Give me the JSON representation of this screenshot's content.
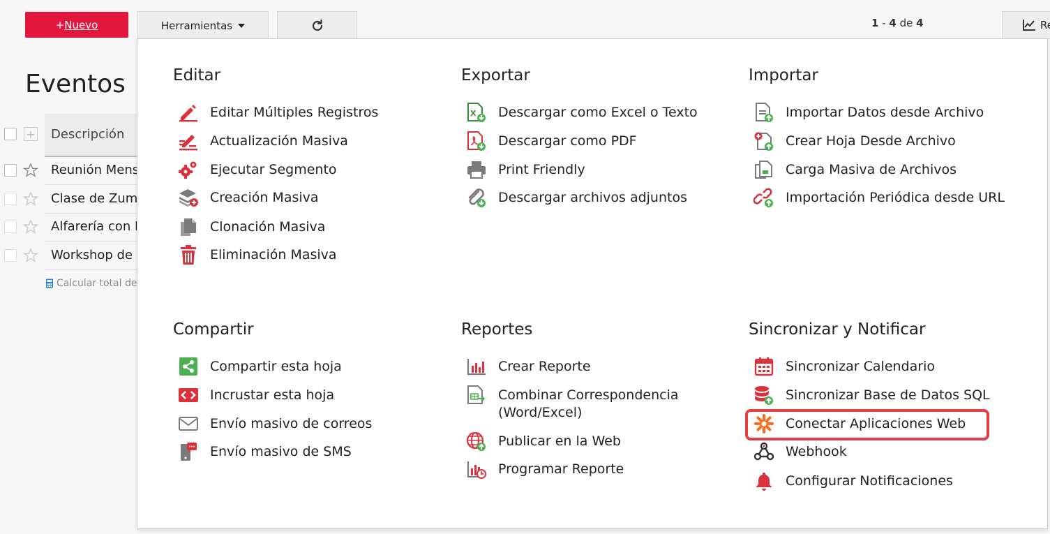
{
  "toolbar": {
    "new_prefix": "+",
    "new_label": "Nuevo",
    "tools_label": "Herramientas",
    "pager_start": "1",
    "pager_sep": " - ",
    "pager_end": "4",
    "pager_of": " de ",
    "pager_total": "4",
    "report_label": "Re"
  },
  "page": {
    "title": "Eventos"
  },
  "table": {
    "column": "Descripción",
    "rows": [
      "Reunión Mens",
      "Clase de Zumb",
      "Alfarería con E",
      "Workshop de C"
    ],
    "calc_label": "Calcular total de"
  },
  "menu": {
    "editar": {
      "title": "Editar",
      "items": [
        {
          "label": "Editar Múltiples Registros",
          "icon": "pencil-multi-icon"
        },
        {
          "label": "Actualización Masiva",
          "icon": "mass-update-icon"
        },
        {
          "label": "Ejecutar Segmento",
          "icon": "gears-icon"
        },
        {
          "label": "Creación Masiva",
          "icon": "layers-add-icon"
        },
        {
          "label": "Clonación Masiva",
          "icon": "clone-icon"
        },
        {
          "label": "Eliminación Masiva",
          "icon": "trash-icon"
        }
      ]
    },
    "exportar": {
      "title": "Exportar",
      "items": [
        {
          "label": "Descargar como Excel o Texto",
          "icon": "excel-download-icon"
        },
        {
          "label": "Descargar como PDF",
          "icon": "pdf-download-icon"
        },
        {
          "label": "Print Friendly",
          "icon": "printer-icon"
        },
        {
          "label": "Descargar archivos adjuntos",
          "icon": "paperclip-download-icon"
        }
      ]
    },
    "importar": {
      "title": "Importar",
      "items": [
        {
          "label": "Importar Datos desde Archivo",
          "icon": "file-import-icon"
        },
        {
          "label": "Crear Hoja Desde Archivo",
          "icon": "sheet-from-file-icon"
        },
        {
          "label": "Carga Masiva de Archivos",
          "icon": "files-upload-icon"
        },
        {
          "label": "Importación Periódica desde URL",
          "icon": "link-import-icon"
        }
      ]
    },
    "compartir": {
      "title": "Compartir",
      "items": [
        {
          "label": "Compartir esta hoja",
          "icon": "share-icon"
        },
        {
          "label": "Incrustar esta hoja",
          "icon": "embed-code-icon"
        },
        {
          "label": "Envío masivo de correos",
          "icon": "envelope-icon"
        },
        {
          "label": "Envío masivo de SMS",
          "icon": "sms-phone-icon"
        }
      ]
    },
    "reportes": {
      "title": "Reportes",
      "items": [
        {
          "label": "Crear Reporte",
          "icon": "bar-chart-icon"
        },
        {
          "label": "Combinar Correspondencia",
          "label2": "(Word/Excel)",
          "icon": "mail-merge-icon"
        },
        {
          "label": "Publicar en la Web",
          "icon": "globe-publish-icon"
        },
        {
          "label": "Programar Reporte",
          "icon": "scheduled-report-icon"
        }
      ]
    },
    "sincronizar": {
      "title": "Sincronizar y Notificar",
      "items": [
        {
          "label": "Sincronizar Calendario",
          "icon": "calendar-icon"
        },
        {
          "label": "Sincronizar Base de Datos SQL",
          "icon": "database-sync-icon"
        },
        {
          "label": "Conectar Aplicaciones Web",
          "icon": "zapier-asterisk-icon"
        },
        {
          "label": "Webhook",
          "icon": "webhook-icon"
        },
        {
          "label": "Configurar Notificaciones",
          "icon": "bell-icon"
        }
      ]
    }
  },
  "colors": {
    "accent": "#e3173e",
    "icon_red": "#d9323c",
    "icon_green": "#4caf50",
    "icon_gray": "#7a7a7a",
    "zapier_orange": "#ff6a1a",
    "highlight": "#e53e44"
  }
}
